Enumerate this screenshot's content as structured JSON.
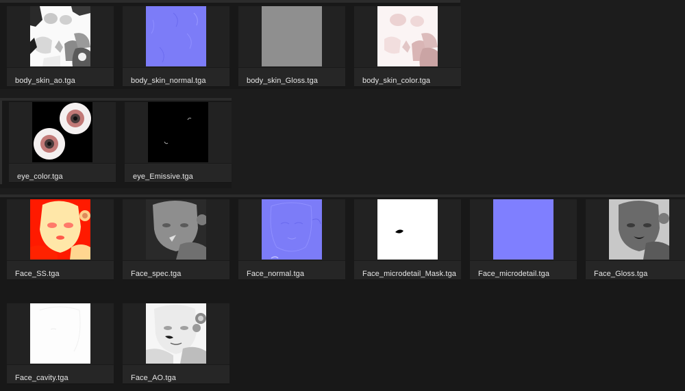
{
  "groups": [
    {
      "files": [
        {
          "name": "body_skin_ao.tga",
          "thumb_icon": "body-ao-map"
        },
        {
          "name": "body_skin_normal.tga",
          "thumb_icon": "body-normal-map"
        },
        {
          "name": "body_skin_Gloss.tga",
          "thumb_icon": "body-gloss-map"
        },
        {
          "name": "body_skin_color.tga",
          "thumb_icon": "body-color-map"
        }
      ]
    },
    {
      "files": [
        {
          "name": "eye_color.tga",
          "thumb_icon": "eye-color-map"
        },
        {
          "name": "eye_Emissive.tga",
          "thumb_icon": "eye-emissive-map"
        }
      ]
    },
    {
      "files": [
        {
          "name": "Face_SS.tga",
          "thumb_icon": "face-ss-map"
        },
        {
          "name": "Face_spec.tga",
          "thumb_icon": "face-spec-map"
        },
        {
          "name": "Face_normal.tga",
          "thumb_icon": "face-normal-map"
        },
        {
          "name": "Face_microdetail_Mask.tga",
          "thumb_icon": "face-microdetail-mask-map"
        },
        {
          "name": "Face_microdetail.tga",
          "thumb_icon": "face-microdetail-map"
        },
        {
          "name": "Face_Gloss.tga",
          "thumb_icon": "face-gloss-map"
        },
        {
          "name": "Face_cavity.tga",
          "thumb_icon": "face-cavity-map"
        },
        {
          "name": "Face_AO.tga",
          "thumb_icon": "face-ao-map"
        }
      ]
    }
  ],
  "colors": {
    "background": "#1c1c1c",
    "tile": "#262626",
    "label": "#e6e6e6",
    "normal_map_blue": "#7f7fff"
  }
}
